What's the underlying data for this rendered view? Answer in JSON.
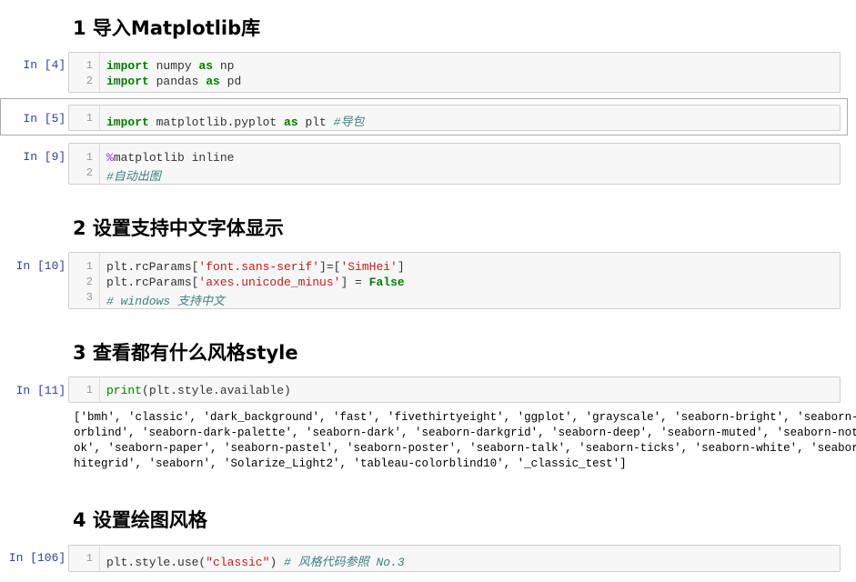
{
  "headings": {
    "h1": "1  导入Matplotlib库",
    "h2": "2  设置支持中文字体显示",
    "h3": "3  查看都有什么风格style",
    "h4": "4  设置绘图风格"
  },
  "cells": {
    "c4": {
      "prompt": "In [4]:",
      "lines": [
        {
          "n": "1",
          "kw1": "import",
          "t1": " numpy ",
          "kw2": "as",
          "t2": " np"
        },
        {
          "n": "2",
          "kw1": "import",
          "t1": " pandas ",
          "kw2": "as",
          "t2": " pd"
        }
      ]
    },
    "c5": {
      "prompt": "In [5]:",
      "lines": [
        {
          "n": "1",
          "kw1": "import",
          "t1": " matplotlib.pyplot ",
          "kw2": "as",
          "t2": " plt ",
          "cm": "#导包"
        }
      ]
    },
    "c9": {
      "prompt": "In [9]:",
      "lines": [
        {
          "n": "1",
          "magic": "%",
          "t1": "matplotlib inline"
        },
        {
          "n": "2",
          "cm": "#自动出图"
        }
      ]
    },
    "c10": {
      "prompt": "In [10]:",
      "lines": [
        {
          "n": "1",
          "t1": "plt.rcParams[",
          "s1": "'font.sans-serif'",
          "t2": "]=[",
          "s2": "'SimHei'",
          "t3": "]"
        },
        {
          "n": "2",
          "t1": "plt.rcParams[",
          "s1": "'axes.unicode_minus'",
          "t2": "] = ",
          "kw": "False"
        },
        {
          "n": "3",
          "cm": "# windows 支持中文"
        }
      ]
    },
    "c11": {
      "prompt": "In [11]:",
      "lines": [
        {
          "n": "1",
          "bi": "print",
          "t1": "(plt.style.available)"
        }
      ],
      "output": [
        "['bmh', 'classic', 'dark_background', 'fast', 'fivethirtyeight', 'ggplot', 'grayscale', 'seaborn-bright', 'seaborn-col",
        "orblind', 'seaborn-dark-palette', 'seaborn-dark', 'seaborn-darkgrid', 'seaborn-deep', 'seaborn-muted', 'seaborn-notebo",
        "ok', 'seaborn-paper', 'seaborn-pastel', 'seaborn-poster', 'seaborn-talk', 'seaborn-ticks', 'seaborn-white', 'seaborn-w",
        "hitegrid', 'seaborn', 'Solarize_Light2', 'tableau-colorblind10', '_classic_test']"
      ]
    },
    "c106": {
      "prompt": "In [106]:",
      "lines": [
        {
          "n": "1",
          "t1": "plt.style.use(",
          "s1": "\"classic\"",
          "t2": ") ",
          "cm": "# 风格代码参照 No.3"
        }
      ]
    }
  },
  "colors": {
    "prompt": "#303f9f",
    "keyword": "#008000",
    "string": "#ba2121",
    "comment": "#408080",
    "magic": "#aa22ff",
    "cell_bg": "#f7f7f7",
    "cell_border": "#cfcfcf"
  }
}
